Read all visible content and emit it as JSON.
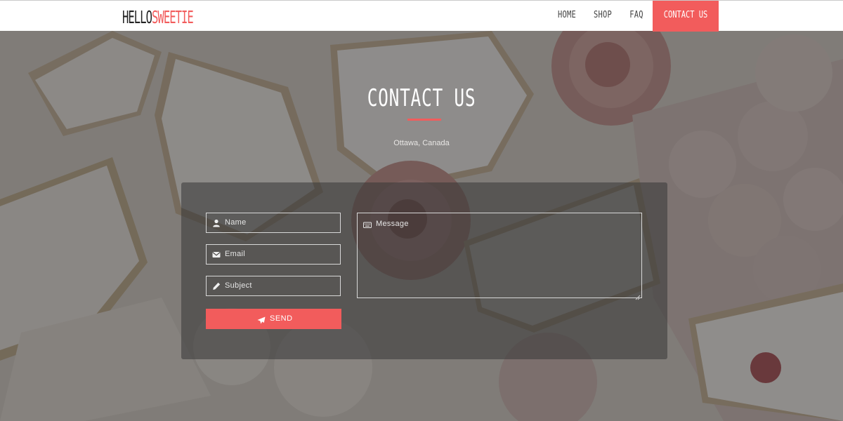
{
  "header": {
    "logo_part1": "HELLO",
    "logo_part2": "SWEETIE",
    "nav": {
      "home": "HOME",
      "shop": "SHOP",
      "faq": "FAQ",
      "contact": "CONTACT US"
    }
  },
  "main": {
    "title": "CONTACT US",
    "location": "Ottawa, Canada"
  },
  "form": {
    "name_placeholder": "Name",
    "email_placeholder": "Email",
    "subject_placeholder": "Subject",
    "message_placeholder": "Message",
    "send_label": "SEND"
  },
  "colors": {
    "accent": "#f25c5c",
    "header_bg": "#ffffff",
    "overlay": "#141212"
  },
  "icons": {
    "name": "user-icon",
    "email": "envelope-icon",
    "subject": "pencil-icon",
    "message": "keyboard-icon",
    "send": "paper-plane-icon"
  }
}
